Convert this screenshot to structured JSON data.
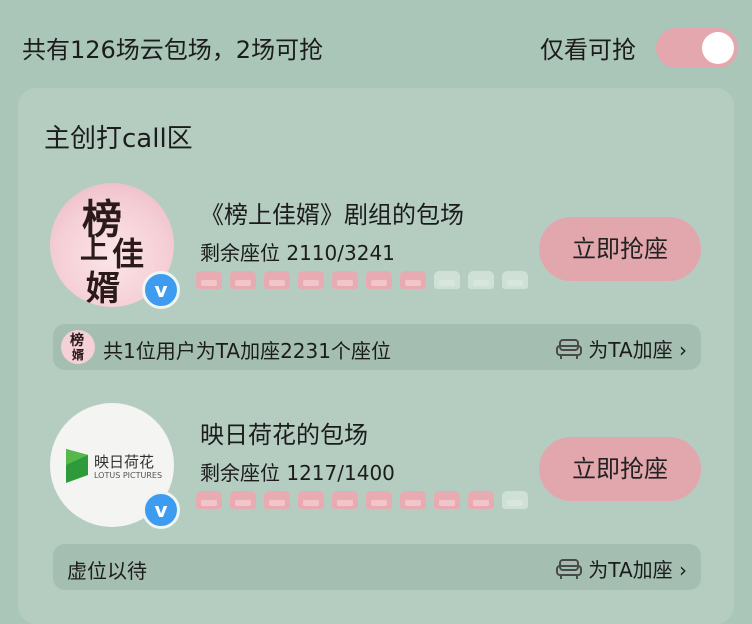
{
  "header": {
    "summary": "共有126场云包场，2场可抢",
    "filter_label": "仅看可抢",
    "filter_on": true
  },
  "panel": {
    "title": "主创打call区",
    "items": [
      {
        "avatar_text": [
          "榜",
          "上",
          "佳",
          "婿"
        ],
        "title": "《榜上佳婿》剧组的包场",
        "seats": "剩余座位 2110/3241",
        "seats_remaining": 2110,
        "seats_total": 3241,
        "button": "立即抢座",
        "sub_text": "共1位用户为TA加座2231个座位",
        "sub_link": "为TA加座 ›"
      },
      {
        "avatar_logo_text": "映日荷花",
        "avatar_logo_sub": "LOTUS PICTURES",
        "title": "映日荷花的包场",
        "seats": "剩余座位 1217/1400",
        "seats_remaining": 1217,
        "seats_total": 1400,
        "button": "立即抢座",
        "sub_text": "虚位以待",
        "sub_link": "为TA加座 ›"
      }
    ]
  },
  "colors": {
    "background": "#aac6b8",
    "panel": "#b5cdc1",
    "accent_pink": "#e2a7ad",
    "verified_blue": "#3e9cf0"
  },
  "icons": [
    "verified-v-icon",
    "sofa-icon",
    "chevron-right-icon",
    "seat-icon"
  ]
}
